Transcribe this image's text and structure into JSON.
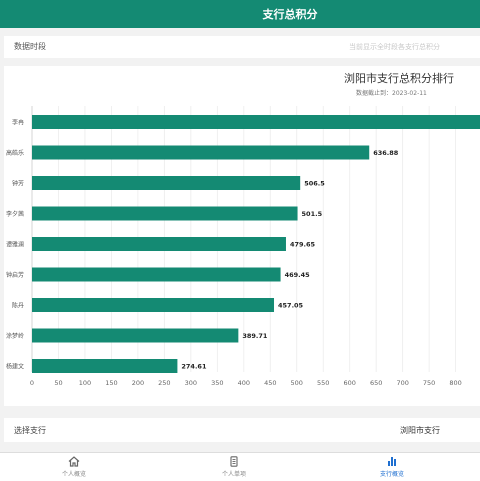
{
  "header": {
    "title": "支行总积分"
  },
  "period": {
    "label": "数据时段",
    "hint": "当前显示全时段各支行总积分"
  },
  "chart_data": {
    "type": "bar",
    "orientation": "horizontal",
    "title": "浏阳市支行总积分排行",
    "subtitle": "数据截止到：2023-02-11",
    "categories": [
      "李冉",
      "高皓乐",
      "钟芳",
      "李夕茜",
      "谭雅澜",
      "钟启芳",
      "陈丹",
      "涂梦岭",
      "杨建文"
    ],
    "values": [
      1000,
      636.88,
      506.5,
      501.5,
      479.65,
      469.45,
      457.05,
      389.71,
      274.61
    ],
    "data_labels": [
      "",
      "636.88",
      "506.5",
      "501.5",
      "479.65",
      "469.45",
      "457.05",
      "389.71",
      "274.61"
    ],
    "x_ticks": [
      "0",
      "50",
      "100",
      "150",
      "200",
      "250",
      "300",
      "350",
      "400",
      "450",
      "500",
      "550",
      "600",
      "650",
      "700",
      "750",
      "800"
    ],
    "xlim": [
      0,
      850
    ],
    "grid": true,
    "bar_color": "#148a73"
  },
  "select": {
    "label": "选择支行",
    "value": "浏阳市支行"
  },
  "tabs": [
    {
      "label": "个人概览",
      "icon": "home-icon",
      "active": false
    },
    {
      "label": "个人单项",
      "icon": "document-icon",
      "active": false
    },
    {
      "label": "支行概览",
      "icon": "bar-chart-icon",
      "active": true
    }
  ],
  "colors": {
    "brand": "#148a73",
    "active_tab": "#1f6fd0"
  }
}
